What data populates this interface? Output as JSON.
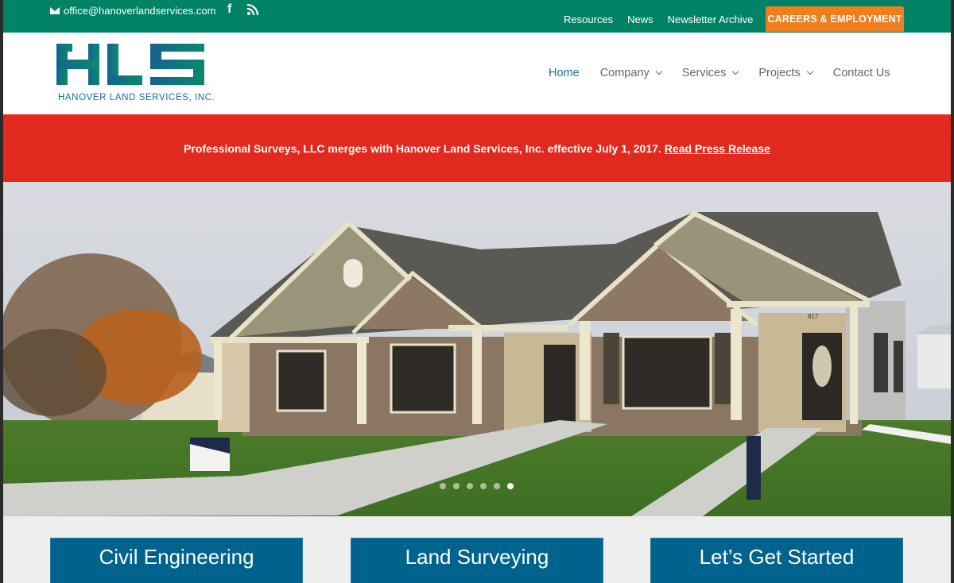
{
  "topbar": {
    "email": "office@hanoverlandservices.com",
    "email_icon": "envelope-icon",
    "social": [
      {
        "name": "facebook",
        "icon": "facebook-icon",
        "glyph": "f"
      },
      {
        "name": "rss",
        "icon": "rss-icon"
      }
    ],
    "links": [
      "Resources",
      "News",
      "Newsletter Archive"
    ],
    "cta": "CAREERS & EMPLOYMENT",
    "cta_color": "#ef7e1f",
    "bg_color": "#008267"
  },
  "logo": {
    "mark": "HLS",
    "tagline": "HANOVER LAND SERVICES, INC."
  },
  "nav": {
    "items": [
      {
        "label": "Home",
        "active": true,
        "dropdown": false
      },
      {
        "label": "Company",
        "active": false,
        "dropdown": true
      },
      {
        "label": "Services",
        "active": false,
        "dropdown": true
      },
      {
        "label": "Projects",
        "active": false,
        "dropdown": true
      },
      {
        "label": "Contact Us",
        "active": false,
        "dropdown": false
      }
    ],
    "active_color": "#1b6e95"
  },
  "announcement": {
    "text": "Professional Surveys, LLC merges with Hanover Land Services, Inc. effective July 1, 2017.",
    "link": "Read Press Release",
    "bg_color": "#e1291f"
  },
  "hero": {
    "image_alt": "Stone and siding duplex homes with green lawn",
    "house_number": "817",
    "slides_total": 6,
    "active_slide": 6
  },
  "services": [
    {
      "label": "Civil Engineering"
    },
    {
      "label": "Land Surveying"
    },
    {
      "label": "Let’s Get Started"
    }
  ]
}
